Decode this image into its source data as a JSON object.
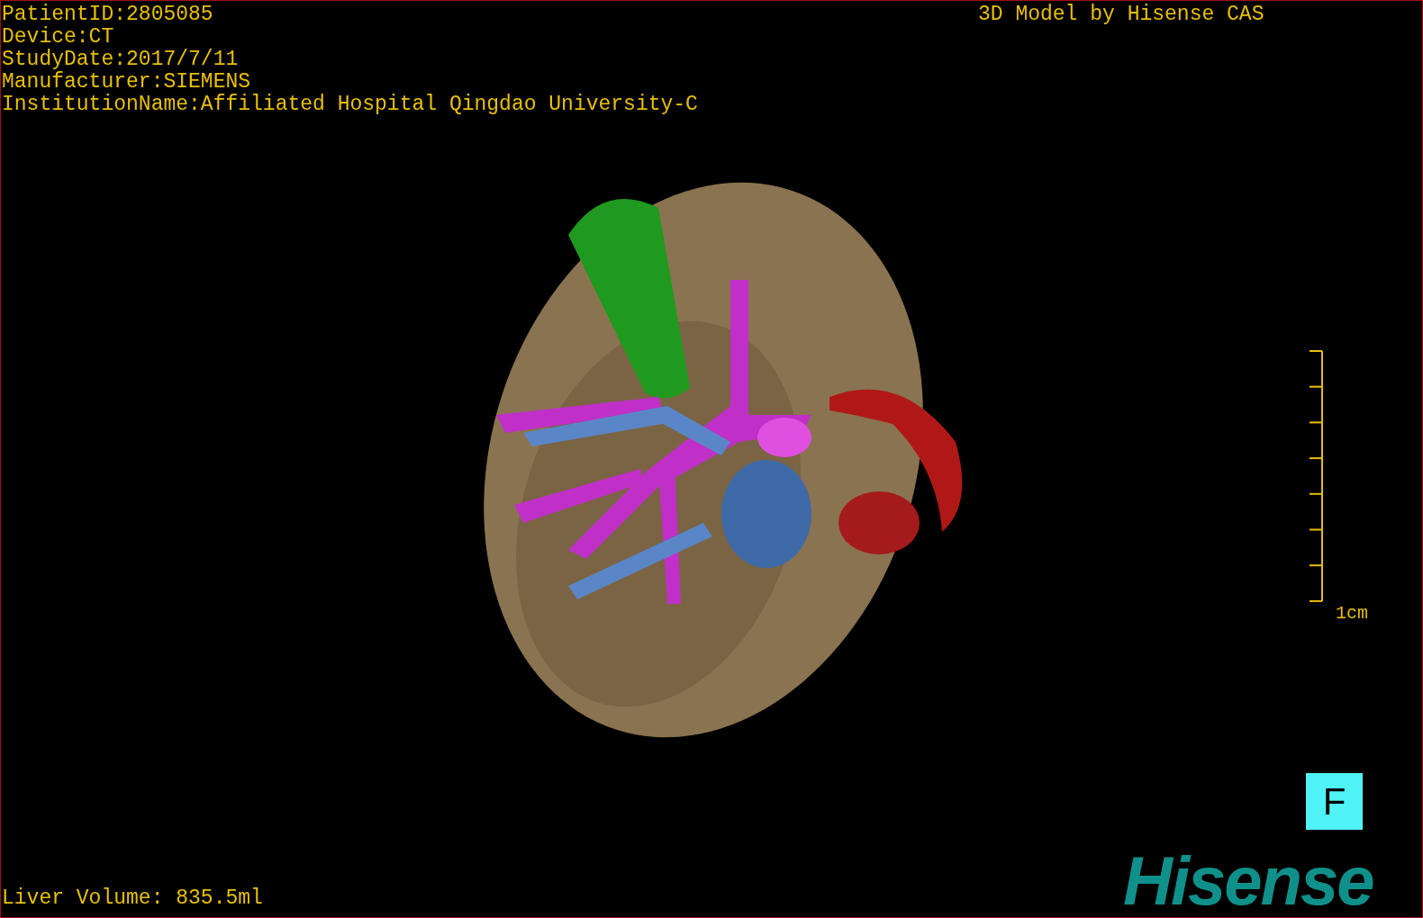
{
  "info_lines": [
    "PatientID:2805085",
    "Device:CT",
    "StudyDate:2017/7/11",
    "Manufacturer:SIEMENS",
    "InstitutionName:Affiliated Hospital Qingdao University-C"
  ],
  "model_credit": "3D Model by Hisense CAS",
  "scale_bar": {
    "label": "1cm"
  },
  "orientation_label": "F",
  "liver_volume": "Liver Volume: 835.5ml",
  "logo": "Hisense"
}
